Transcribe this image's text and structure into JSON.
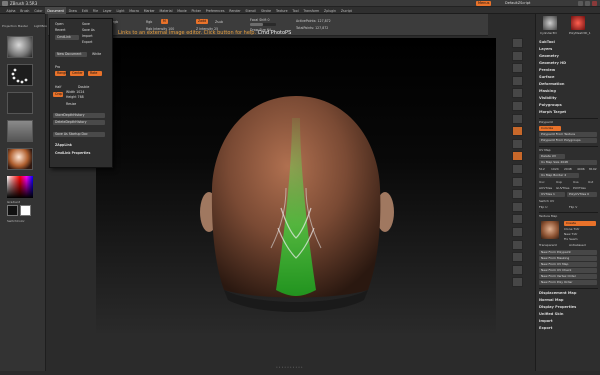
{
  "titlebar": {
    "title": "ZBrush 3.5R3",
    "menu_badge": "Menus",
    "script": "DefaultZScript"
  },
  "menubar": {
    "items": [
      "Alpha",
      "Brush",
      "Color",
      "Document",
      "Draw",
      "Edit",
      "File",
      "Layer",
      "Light",
      "Macro",
      "Marker",
      "Material",
      "Movie",
      "Picker",
      "Preferences",
      "Render",
      "Stencil",
      "Stroke",
      "Texture",
      "Tool",
      "Transform",
      "Zplugin",
      "Zscript"
    ],
    "active_index": 3
  },
  "toolbar": {
    "mrgb": "Mrgb",
    "rgb": "Rgb",
    "m": "M",
    "zadd": "Zadd",
    "zsub": "Zsub",
    "focal_shift": "Focal Shift 0",
    "rgb_intensity": "Rgb Intensity 100",
    "z_intensity": "Z Intensity 25",
    "draw_size": "Draw Size 64",
    "active_points": "ActivePoints: 127,872",
    "total_points": "TotalPoints: 127,872"
  },
  "help_overlay": {
    "prefix": "Links to an external image editor. Click button for help.",
    "suffix": "Cmd PhotoPS"
  },
  "left_shelf": {
    "projection_master": "Projection Master",
    "light_box": "LightBox",
    "quick_sketch": "Quick Sketch",
    "gradient_label": "Gradient",
    "switch_color_label": "SwitchColor"
  },
  "document_menu": {
    "open": "Open",
    "save": "Save",
    "save_as": "Save As",
    "revert": "Revert",
    "cmd_link": "CmdLink",
    "import": "Import",
    "export": "Export",
    "new_document": "New Document",
    "white": "White",
    "range": "Range",
    "center": "Center",
    "rate": "Rate",
    "pro": "Pro",
    "half": "Half",
    "double": "Double",
    "width": "Width 1024",
    "height": "Height 768",
    "crop": "Crop",
    "resize": "Resize",
    "store_depth_history": "StoreDepthHistory",
    "delete_depth_history": "DeleteDepthHistory",
    "save_as_startup": "Save As Startup Doc",
    "zapplink": "ZAppLink",
    "cmd_link_props": "CmdLink Properties"
  },
  "right_icons": {
    "orange_index": [
      7,
      9
    ]
  },
  "right_panel": {
    "header_icon_label": "Cylinder3D",
    "polymesh_label": "PolyMesh3D_1",
    "subtool": "SubTool",
    "layers": "Layers",
    "geometry": "Geometry",
    "geometry_hd": "Geometry HD",
    "preview": "Preview",
    "surface": "Surface",
    "deformation": "Deformation",
    "masking": "Masking",
    "visibility": "Visibility",
    "polygroups": "Polygroups",
    "morph_target": "Morph Target",
    "polypaint": "Polypaint",
    "colorize": "Colorize",
    "polypaint_from_texture": "Polypaint From Texture",
    "polypaint_from_polygroup": "Polypaint From Polygroups",
    "uv_map": "UV Map",
    "delete_uv": "Delete UV",
    "uv_map_size": "Uv Map Size 2048",
    "uv_1": "512",
    "uv_2": "1024",
    "uv_3": "2048",
    "uv_4": "4096",
    "uv_5": "8192",
    "uv_map_border": "Uv Map Border 4",
    "uvc": "Uvc",
    "uvp": "Uvp",
    "uvs": "Uvs",
    "uvt": "Uvt",
    "adaptive_uv_tiles": "AUVTiles",
    "guv_tiles": "GUVTiles",
    "puv_tiles": "PUVTiles",
    "uv_tiles": "UVTiles",
    "hprtiles": "UVTiles 1",
    "polyuv_tiles": "PolyUVTiles 0",
    "uv_check": "Switch UV",
    "flip_u": "Flip U",
    "flip_v": "Flip V",
    "texture_map": "Texture Map",
    "create": "Create",
    "clone_txtr": "Clone Txtr",
    "new_txtr": "New Txtr",
    "fix_seam": "Fix Seam",
    "transparent": "Transparent",
    "antialiased": "Antialiased",
    "new_from_polypaint": "New From Polypaint",
    "new_from_masking": "New From Masking",
    "new_from_uv_map": "New From UV Map",
    "new_from_uv_check": "New From UV Check",
    "new_from_vertex_order": "New From Vertex Order",
    "new_from_poly_order": "New From Poly Order",
    "displacement_map": "Displacement Map",
    "normal_map": "Normal Map",
    "display_properties": "Display Properties",
    "unified_skin": "Unified Skin",
    "import": "Import",
    "export": "Export"
  },
  "colors": {
    "accent_orange": "#e9722a",
    "panel_bg": "#2e2e2e"
  }
}
